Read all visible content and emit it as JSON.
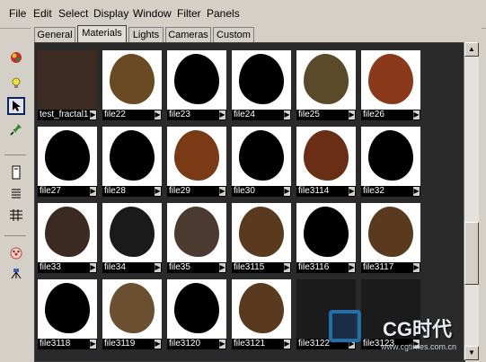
{
  "menubar": {
    "items": [
      "File",
      "Edit",
      "Select",
      "Display",
      "Window",
      "Filter",
      "Panels"
    ]
  },
  "toolbar": {
    "icons": [
      "render-globe-icon",
      "light-bulb-icon",
      "select-arrow-icon",
      "pin-icon",
      "single-column-icon",
      "list-view-icon",
      "grid-view-icon",
      "clown-face-icon",
      "node-icon"
    ]
  },
  "tabs": [
    "General",
    "Materials",
    "Lights",
    "Cameras",
    "Custom"
  ],
  "active_tab": "Materials",
  "materials": [
    {
      "name": "test_fractal1",
      "dark": true,
      "color": "#3d2a20"
    },
    {
      "name": "file22",
      "dark": false,
      "color": "#6a4a22"
    },
    {
      "name": "file23",
      "dark": false,
      "color": "#000000"
    },
    {
      "name": "file24",
      "dark": false,
      "color": "#000000"
    },
    {
      "name": "file25",
      "dark": false,
      "color": "#5a4a2a"
    },
    {
      "name": "file26",
      "dark": false,
      "color": "#8a3a1a"
    },
    {
      "name": "file27",
      "dark": false,
      "color": "#000000"
    },
    {
      "name": "file28",
      "dark": false,
      "color": "#000000"
    },
    {
      "name": "file29",
      "dark": false,
      "color": "#7a3a16"
    },
    {
      "name": "file30",
      "dark": false,
      "color": "#000000"
    },
    {
      "name": "file3114",
      "dark": false,
      "color": "#6a2e14"
    },
    {
      "name": "file32",
      "dark": false,
      "color": "#000000"
    },
    {
      "name": "file33",
      "dark": false,
      "color": "#3a2a22"
    },
    {
      "name": "file34",
      "dark": false,
      "color": "#1a1a1a"
    },
    {
      "name": "file35",
      "dark": false,
      "color": "#4a3a30"
    },
    {
      "name": "file3115",
      "dark": false,
      "color": "#5a3a1e"
    },
    {
      "name": "file3116",
      "dark": false,
      "color": "#000000"
    },
    {
      "name": "file3117",
      "dark": false,
      "color": "#5a3a1e"
    },
    {
      "name": "file3118",
      "dark": false,
      "color": "#000000"
    },
    {
      "name": "file3119",
      "dark": false,
      "color": "#6a5030"
    },
    {
      "name": "file3120",
      "dark": false,
      "color": "#000000"
    },
    {
      "name": "file3121",
      "dark": false,
      "color": "#5a3a1e"
    },
    {
      "name": "file3122",
      "dark": true,
      "color": "#1b1b1b"
    },
    {
      "name": "file3123",
      "dark": true,
      "color": "#1b1b1b"
    }
  ],
  "watermark": {
    "brand": "CG时代",
    "url": "www.cgtimes.com.cn"
  }
}
